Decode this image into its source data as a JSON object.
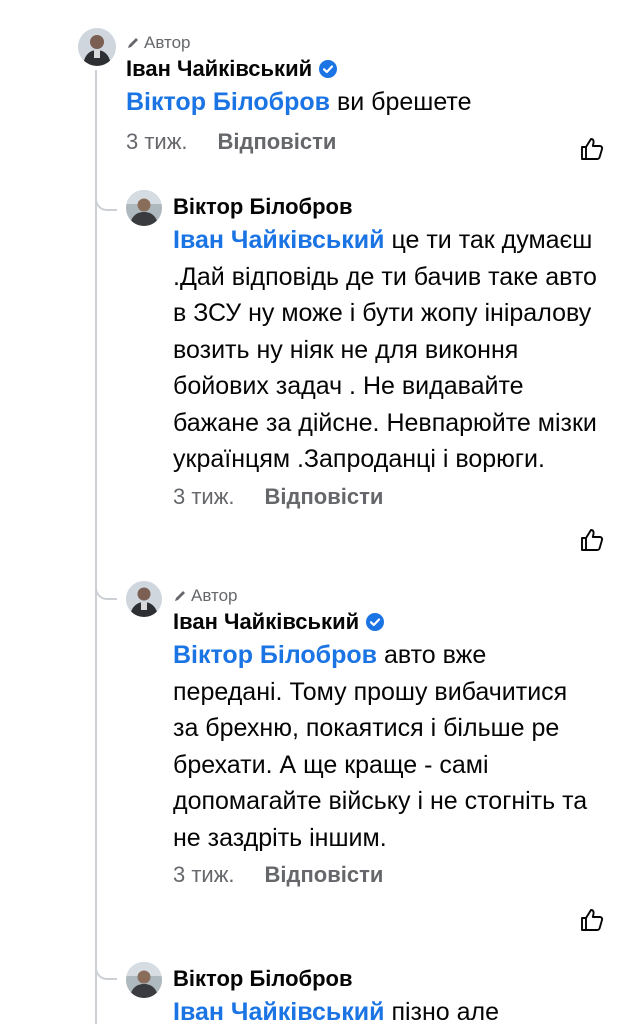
{
  "comments": [
    {
      "author_tag": "Автор",
      "name": "Іван Чайківський",
      "mention": "Віктор Білобров",
      "text": " ви брешете",
      "time": "3 тиж.",
      "reply": "Відповісти"
    },
    {
      "author_tag": "",
      "name": "Віктор Білобров",
      "mention": "Іван Чайківський",
      "text": "  це ти так думаєш .Дай відповідь де ти бачив таке авто в ЗСУ ну може і бути жопу інiралову возить ну ніяк не для виконня бойових задач . Не видавайте бажане за дійсне. Невпарюйте мізки українцям .Запроданці і ворюги.",
      "time": "3 тиж.",
      "reply": "Відповісти"
    },
    {
      "author_tag": "Автор",
      "name": "Іван Чайківський",
      "mention": "Віктор Білобров",
      "text": " авто вже передані. Тому прошу вибачитися за брехню, покаятися і більше ре брехати. А ще краще - самі допомагайте війську і не стогніть та не заздріть іншим.",
      "time": "3 тиж.",
      "reply": "Відповісти"
    },
    {
      "author_tag": "",
      "name": "Віктор Білобров",
      "mention": "Іван Чайківський",
      "text": " пізно але",
      "time": "",
      "reply": ""
    }
  ],
  "icons": {
    "verified_color": "#1b74e4",
    "like": "thumbs-up-outline-icon",
    "pen": "pen-icon"
  }
}
